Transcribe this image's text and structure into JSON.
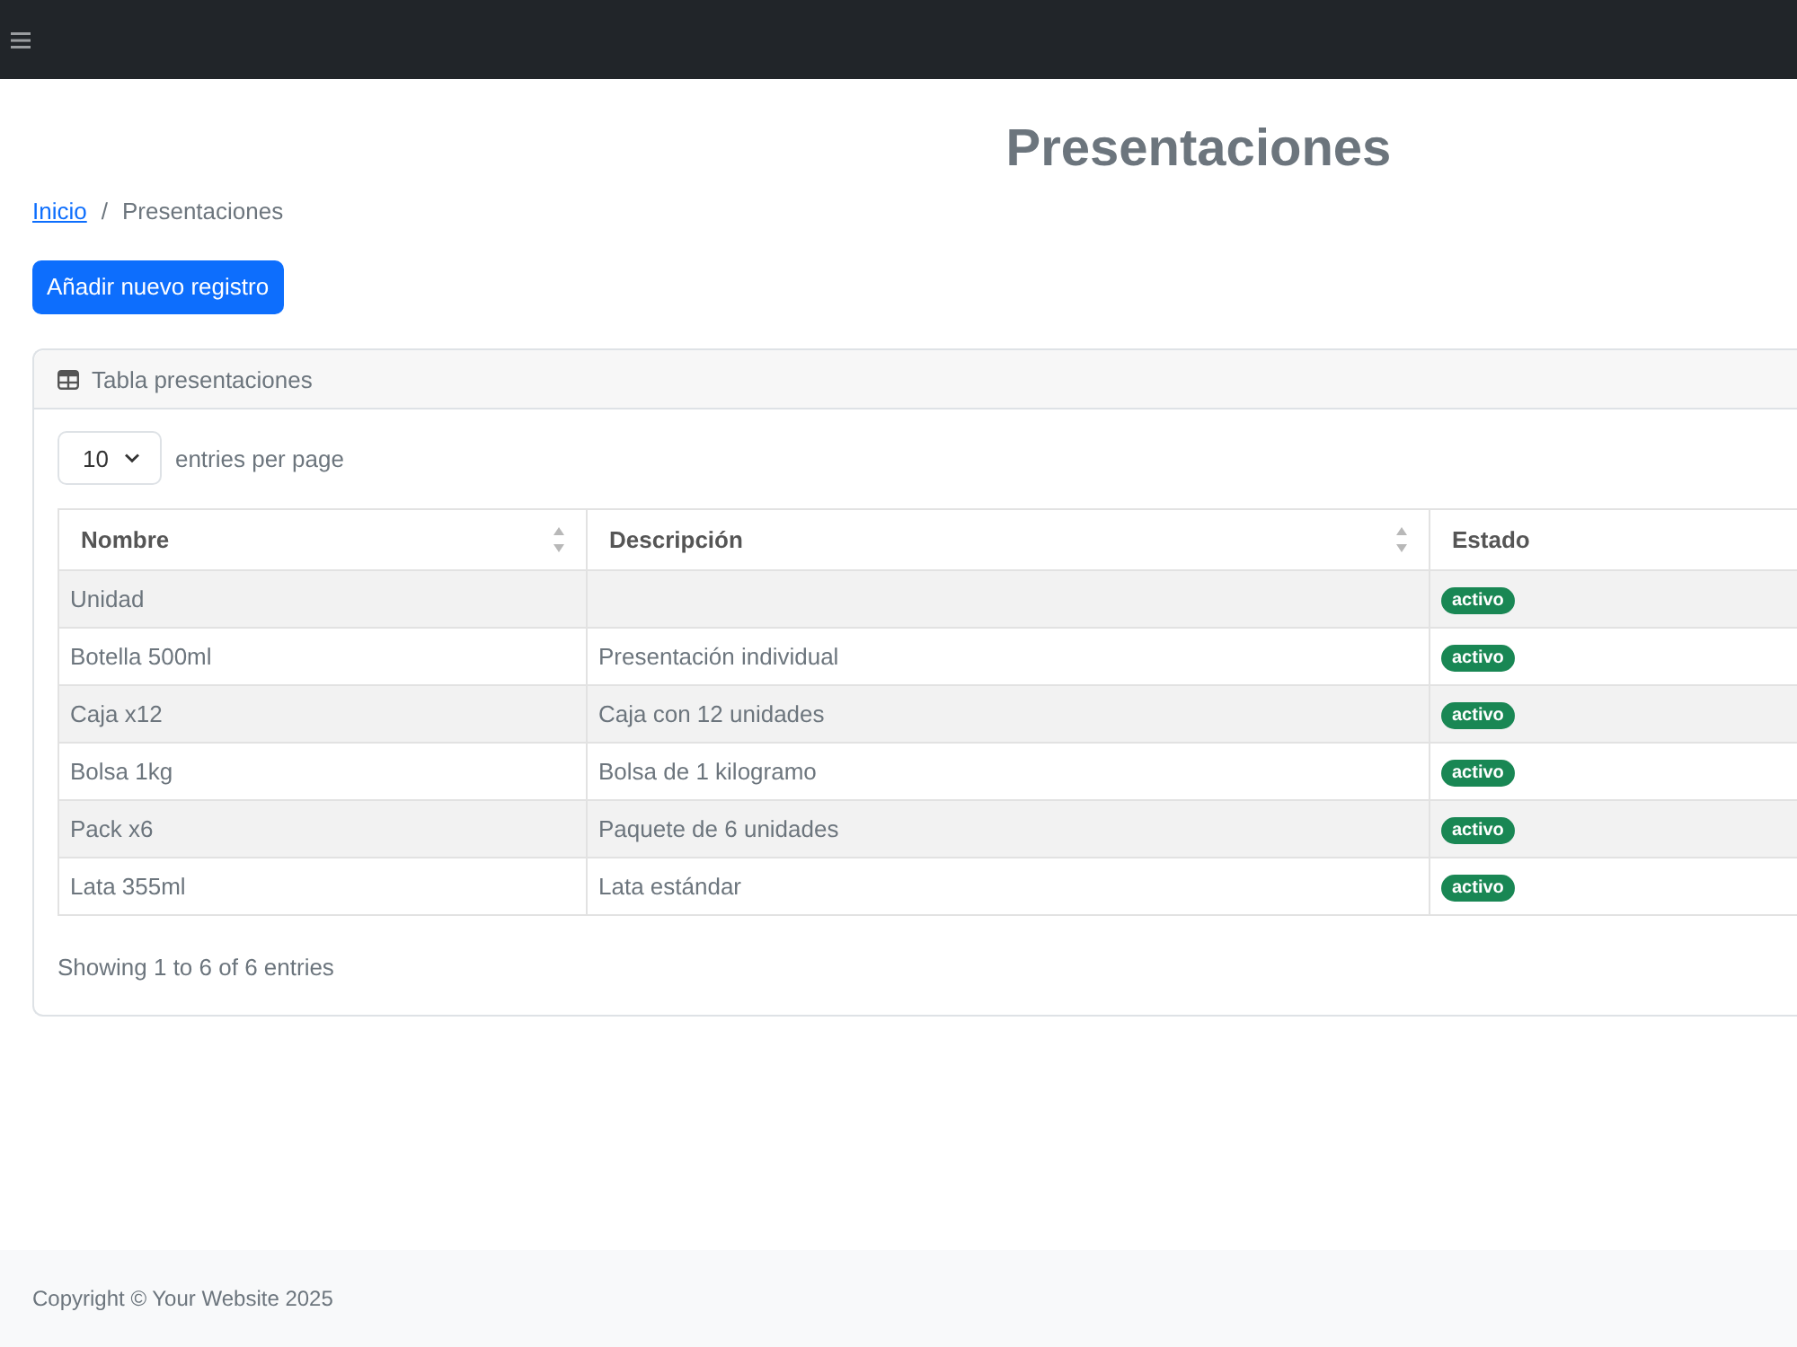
{
  "page_title": "Presentaciones",
  "breadcrumb": {
    "separator": "/",
    "items": [
      {
        "label": "Inicio",
        "kind": "link"
      },
      {
        "label": "Presentaciones",
        "kind": "current"
      }
    ]
  },
  "add_button": {
    "label": "Añadir nuevo registro"
  },
  "card": {
    "title": "Tabla presentaciones",
    "page_size": {
      "value": "10",
      "label": "entries per page"
    },
    "table": {
      "columns": [
        {
          "label": "Nombre",
          "sortable": true
        },
        {
          "label": "Descripción",
          "sortable": true
        },
        {
          "label": "Estado",
          "sortable": false
        }
      ],
      "rows": [
        {
          "nombre": "Unidad",
          "estado": "activo"
        },
        {
          "nombre": "Botella 500ml",
          "descripcion": "Presentación individual",
          "estado": "activo"
        },
        {
          "nombre": "Caja x12",
          "descripcion": "Caja con 12 unidades",
          "estado": "activo"
        },
        {
          "nombre": "Bolsa 1kg",
          "descripcion": "Bolsa de 1 kilogramo",
          "estado": "activo"
        },
        {
          "nombre": "Pack x6",
          "descripcion": "Paquete de 6 unidades",
          "estado": "activo"
        },
        {
          "nombre": "Lata 355ml",
          "descripcion": "Lata estándar",
          "estado": "activo"
        }
      ]
    },
    "info": "Showing 1 to 6 of 6 entries"
  },
  "footer": {
    "text": "Copyright © Your Website 2025"
  }
}
